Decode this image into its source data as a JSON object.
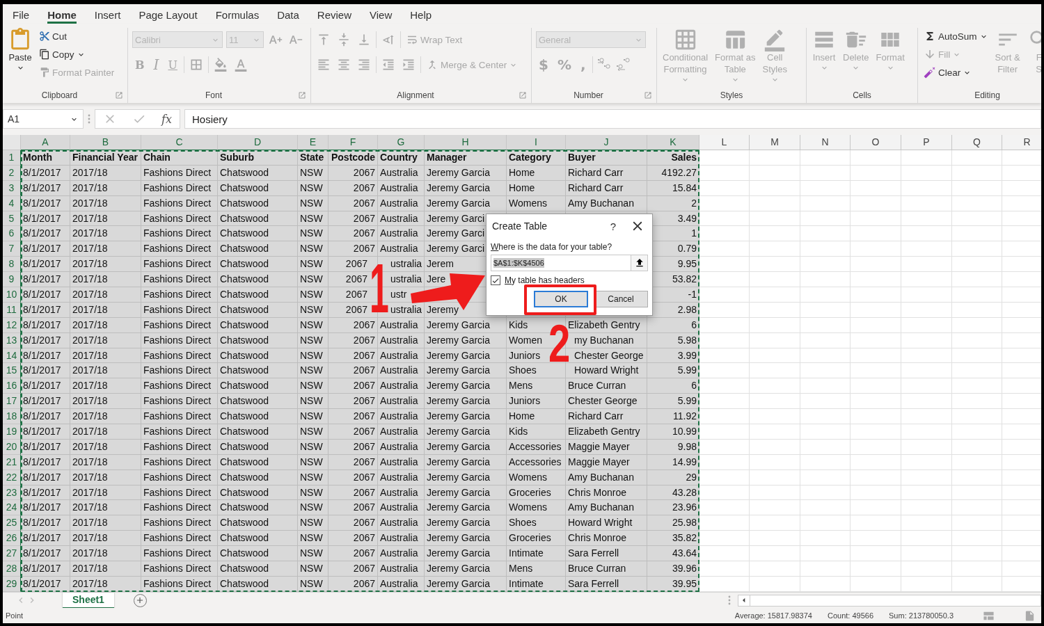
{
  "ribbon_tabs": [
    {
      "label": "File",
      "selected": false
    },
    {
      "label": "Home",
      "selected": true
    },
    {
      "label": "Insert",
      "selected": false
    },
    {
      "label": "Page Layout",
      "selected": false
    },
    {
      "label": "Formulas",
      "selected": false
    },
    {
      "label": "Data",
      "selected": false
    },
    {
      "label": "Review",
      "selected": false
    },
    {
      "label": "View",
      "selected": false
    },
    {
      "label": "Help",
      "selected": false
    }
  ],
  "ribbon": [
    {
      "kind": "clipboard",
      "title": "Clipboard",
      "items": [
        {
          "label": "Paste",
          "disabled": false
        },
        {
          "label": "Cut",
          "disabled": false
        },
        {
          "label": "Copy",
          "disabled": false
        },
        {
          "label": "Format Painter",
          "disabled": true
        }
      ]
    },
    {
      "kind": "font",
      "title": "Font",
      "font": "Calibri",
      "size": "11",
      "styles": [
        "B",
        "I",
        "U"
      ],
      "disabled": true
    },
    {
      "kind": "alignment",
      "title": "Alignment",
      "items": [
        {
          "label": "Wrap Text"
        },
        {
          "label": "Merge & Center"
        }
      ],
      "disabled": true
    },
    {
      "kind": "number",
      "title": "Number",
      "format": "General",
      "symbols": [
        "$",
        "%",
        ","
      ],
      "disabled": true
    },
    {
      "kind": "large",
      "title": "Styles",
      "items": [
        {
          "lines": [
            "Conditional",
            "Formatting"
          ],
          "disabled": true
        },
        {
          "lines": [
            "Format as",
            "Table"
          ],
          "disabled": true
        },
        {
          "lines": [
            "Cell",
            "Styles"
          ],
          "disabled": true
        }
      ]
    },
    {
      "kind": "large",
      "title": "Cells",
      "items": [
        {
          "lines": [
            "Insert"
          ],
          "disabled": true
        },
        {
          "lines": [
            "Delete"
          ],
          "disabled": true
        },
        {
          "lines": [
            "Format"
          ],
          "disabled": true
        }
      ]
    },
    {
      "kind": "editing",
      "title": "Editing",
      "items": [
        {
          "label": "AutoSum",
          "disabled": false
        },
        {
          "label": "Fill",
          "disabled": true
        },
        {
          "label": "Clear",
          "disabled": false
        }
      ],
      "large": [
        {
          "lines": [
            "Sort &",
            "Filter"
          ],
          "disabled": true
        },
        {
          "lines": [
            "F",
            "S"
          ],
          "disabled": true
        }
      ]
    }
  ],
  "formula_bar": {
    "name_box": "A1",
    "fx": "fx",
    "formula": "Hosiery"
  },
  "grid": {
    "marquee": true,
    "columns": [
      {
        "label": "A",
        "selected": true,
        "kind": "text"
      },
      {
        "label": "B",
        "selected": true,
        "kind": "text"
      },
      {
        "label": "C",
        "selected": true,
        "kind": "text"
      },
      {
        "label": "D",
        "selected": true,
        "kind": "text"
      },
      {
        "label": "E",
        "selected": true,
        "kind": "text"
      },
      {
        "label": "F",
        "selected": true,
        "kind": "number"
      },
      {
        "label": "G",
        "selected": true,
        "kind": "text"
      },
      {
        "label": "H",
        "selected": true,
        "kind": "text"
      },
      {
        "label": "I",
        "selected": true,
        "kind": "text"
      },
      {
        "label": "J",
        "selected": true,
        "kind": "text"
      },
      {
        "label": "K",
        "selected": true,
        "kind": "number"
      },
      {
        "label": "L",
        "selected": false,
        "kind": "text"
      },
      {
        "label": "M",
        "selected": false,
        "kind": "text"
      },
      {
        "label": "N",
        "selected": false,
        "kind": "text"
      },
      {
        "label": "O",
        "selected": false,
        "kind": "text"
      },
      {
        "label": "P",
        "selected": false,
        "kind": "text"
      },
      {
        "label": "Q",
        "selected": false,
        "kind": "text"
      },
      {
        "label": "R",
        "selected": false,
        "kind": "text"
      }
    ],
    "rows": [
      {
        "number": "1",
        "selected": true,
        "kind": "header",
        "cells": [
          "Month",
          "Financial Year",
          "Chain",
          "Suburb",
          "State",
          "Postcode",
          "Country",
          "Manager",
          "Category",
          "Buyer",
          "Sales"
        ]
      },
      {
        "number": "2",
        "selected": true,
        "kind": "data",
        "cells": [
          "8/1/2017",
          "2017/18",
          "Fashions Direct",
          "Chatswood",
          "NSW",
          "2067",
          "Australia",
          "Jeremy Garcia",
          "Home",
          "Richard Carr",
          "4192.27"
        ]
      },
      {
        "number": "3",
        "selected": true,
        "kind": "data",
        "cells": [
          "8/1/2017",
          "2017/18",
          "Fashions Direct",
          "Chatswood",
          "NSW",
          "2067",
          "Australia",
          "Jeremy Garcia",
          "Home",
          "Richard Carr",
          "15.84"
        ]
      },
      {
        "number": "4",
        "selected": true,
        "kind": "data",
        "cells": [
          "8/1/2017",
          "2017/18",
          "Fashions Direct",
          "Chatswood",
          "NSW",
          "2067",
          "Australia",
          "Jeremy Garcia",
          "Womens",
          "Amy Buchanan",
          "2"
        ]
      },
      {
        "number": "5",
        "selected": true,
        "kind": "data",
        "cells": [
          "8/1/2017",
          "2017/18",
          "Fashions Direct",
          "Chatswood",
          "NSW",
          "2067",
          "Australia",
          "Jeremy Garci",
          null,
          null,
          "3.49"
        ]
      },
      {
        "number": "6",
        "selected": true,
        "kind": "data",
        "cells": [
          "8/1/2017",
          "2017/18",
          "Fashions Direct",
          "Chatswood",
          "NSW",
          "2067",
          "Australia",
          "Jeremy Garci",
          null,
          null,
          "1"
        ]
      },
      {
        "number": "7",
        "selected": true,
        "kind": "data",
        "cells": [
          "8/1/2017",
          "2017/18",
          "Fashions Direct",
          "Chatswood",
          "NSW",
          "2067",
          "Australia",
          "Jeremy Garci",
          null,
          null,
          "0.79"
        ]
      },
      {
        "number": "8",
        "selected": true,
        "kind": "data",
        "cells": [
          "8/1/2017",
          "2017/18",
          "Fashions Direct",
          "Chatswood",
          "NSW",
          "2067",
          "ustralia",
          "Jerem",
          null,
          null,
          "9.95"
        ]
      },
      {
        "number": "9",
        "selected": true,
        "kind": "data",
        "cells": [
          "8/1/2017",
          "2017/18",
          "Fashions Direct",
          "Chatswood",
          "NSW",
          "2067",
          "ustralia",
          "Jere",
          null,
          null,
          "53.82"
        ]
      },
      {
        "number": "10",
        "selected": true,
        "kind": "data",
        "cells": [
          "8/1/2017",
          "2017/18",
          "Fashions Direct",
          "Chatswood",
          "NSW",
          "2067",
          "ustr",
          null,
          null,
          null,
          "-1"
        ]
      },
      {
        "number": "11",
        "selected": true,
        "kind": "data",
        "cells": [
          "8/1/2017",
          "2017/18",
          "Fashions Direct",
          "Chatswood",
          "NSW",
          "2067",
          "ustralia",
          "Jeremy",
          null,
          null,
          "2.98"
        ]
      },
      {
        "number": "12",
        "selected": true,
        "kind": "data",
        "cells": [
          "8/1/2017",
          "2017/18",
          "Fashions Direct",
          "Chatswood",
          "NSW",
          "2067",
          "Australia",
          "Jeremy Garcia",
          "Kids",
          "Elizabeth Gentry",
          "6"
        ]
      },
      {
        "number": "13",
        "selected": true,
        "kind": "data",
        "cells": [
          "8/1/2017",
          "2017/18",
          "Fashions Direct",
          "Chatswood",
          "NSW",
          "2067",
          "Australia",
          "Jeremy Garcia",
          "Women",
          "my Buchanan",
          "5.98"
        ]
      },
      {
        "number": "14",
        "selected": true,
        "kind": "data",
        "cells": [
          "8/1/2017",
          "2017/18",
          "Fashions Direct",
          "Chatswood",
          "NSW",
          "2067",
          "Australia",
          "Jeremy Garcia",
          "Juniors",
          "Chester George",
          "3.99"
        ]
      },
      {
        "number": "15",
        "selected": true,
        "kind": "data",
        "cells": [
          "8/1/2017",
          "2017/18",
          "Fashions Direct",
          "Chatswood",
          "NSW",
          "2067",
          "Australia",
          "Jeremy Garcia",
          "Shoes",
          "Howard Wright",
          "5.99"
        ]
      },
      {
        "number": "16",
        "selected": true,
        "kind": "data",
        "cells": [
          "8/1/2017",
          "2017/18",
          "Fashions Direct",
          "Chatswood",
          "NSW",
          "2067",
          "Australia",
          "Jeremy Garcia",
          "Mens",
          "Bruce Curran",
          "6"
        ]
      },
      {
        "number": "17",
        "selected": true,
        "kind": "data",
        "cells": [
          "8/1/2017",
          "2017/18",
          "Fashions Direct",
          "Chatswood",
          "NSW",
          "2067",
          "Australia",
          "Jeremy Garcia",
          "Juniors",
          "Chester George",
          "5.99"
        ]
      },
      {
        "number": "18",
        "selected": true,
        "kind": "data",
        "cells": [
          "8/1/2017",
          "2017/18",
          "Fashions Direct",
          "Chatswood",
          "NSW",
          "2067",
          "Australia",
          "Jeremy Garcia",
          "Home",
          "Richard Carr",
          "11.92"
        ]
      },
      {
        "number": "19",
        "selected": true,
        "kind": "data",
        "cells": [
          "8/1/2017",
          "2017/18",
          "Fashions Direct",
          "Chatswood",
          "NSW",
          "2067",
          "Australia",
          "Jeremy Garcia",
          "Kids",
          "Elizabeth Gentry",
          "10.99"
        ]
      },
      {
        "number": "20",
        "selected": true,
        "kind": "data",
        "cells": [
          "8/1/2017",
          "2017/18",
          "Fashions Direct",
          "Chatswood",
          "NSW",
          "2067",
          "Australia",
          "Jeremy Garcia",
          "Accessories",
          "Maggie Mayer",
          "9.98"
        ]
      },
      {
        "number": "21",
        "selected": true,
        "kind": "data",
        "cells": [
          "8/1/2017",
          "2017/18",
          "Fashions Direct",
          "Chatswood",
          "NSW",
          "2067",
          "Australia",
          "Jeremy Garcia",
          "Accessories",
          "Maggie Mayer",
          "14.99"
        ]
      },
      {
        "number": "22",
        "selected": true,
        "kind": "data",
        "cells": [
          "8/1/2017",
          "2017/18",
          "Fashions Direct",
          "Chatswood",
          "NSW",
          "2067",
          "Australia",
          "Jeremy Garcia",
          "Womens",
          "Amy Buchanan",
          "29"
        ]
      },
      {
        "number": "23",
        "selected": true,
        "kind": "data",
        "cells": [
          "8/1/2017",
          "2017/18",
          "Fashions Direct",
          "Chatswood",
          "NSW",
          "2067",
          "Australia",
          "Jeremy Garcia",
          "Groceries",
          "Chris Monroe",
          "43.28"
        ]
      },
      {
        "number": "24",
        "selected": true,
        "kind": "data",
        "cells": [
          "8/1/2017",
          "2017/18",
          "Fashions Direct",
          "Chatswood",
          "NSW",
          "2067",
          "Australia",
          "Jeremy Garcia",
          "Womens",
          "Amy Buchanan",
          "23.96"
        ]
      },
      {
        "number": "25",
        "selected": true,
        "kind": "data",
        "cells": [
          "8/1/2017",
          "2017/18",
          "Fashions Direct",
          "Chatswood",
          "NSW",
          "2067",
          "Australia",
          "Jeremy Garcia",
          "Shoes",
          "Howard Wright",
          "25.98"
        ]
      },
      {
        "number": "26",
        "selected": true,
        "kind": "data",
        "cells": [
          "8/1/2017",
          "2017/18",
          "Fashions Direct",
          "Chatswood",
          "NSW",
          "2067",
          "Australia",
          "Jeremy Garcia",
          "Groceries",
          "Chris Monroe",
          "35.82"
        ]
      },
      {
        "number": "27",
        "selected": true,
        "kind": "data",
        "cells": [
          "8/1/2017",
          "2017/18",
          "Fashions Direct",
          "Chatswood",
          "NSW",
          "2067",
          "Australia",
          "Jeremy Garcia",
          "Intimate",
          "Sara Ferrell",
          "43.64"
        ]
      },
      {
        "number": "28",
        "selected": true,
        "kind": "data",
        "cells": [
          "8/1/2017",
          "2017/18",
          "Fashions Direct",
          "Chatswood",
          "NSW",
          "2067",
          "Australia",
          "Jeremy Garcia",
          "Mens",
          "Bruce Curran",
          "39.96"
        ]
      },
      {
        "number": "29",
        "selected": true,
        "kind": "data",
        "cells": [
          "8/1/2017",
          "2017/18",
          "Fashions Direct",
          "Chatswood",
          "NSW",
          "2067",
          "Australia",
          "Jeremy Garcia",
          "Intimate",
          "Sara Ferrell",
          "39.95"
        ]
      }
    ]
  },
  "dialog": {
    "title": "Create Table",
    "help": "?",
    "prompt": "Where is the data for your table?",
    "range": "$A$1:$K$4506",
    "headers_checkbox": {
      "label": "My table has headers",
      "checked": true
    },
    "buttons": [
      {
        "label": "OK",
        "default": true
      },
      {
        "label": "Cancel",
        "default": false
      }
    ]
  },
  "annotations": [
    {
      "kind": "number",
      "text": "1"
    },
    {
      "kind": "arrow"
    },
    {
      "kind": "number",
      "text": "2"
    },
    {
      "kind": "highlight"
    }
  ],
  "sheet_tabs": [
    {
      "label": "Sheet1",
      "selected": true
    }
  ],
  "status_bar": {
    "mode": "Point",
    "stats": [
      "Average: 15817.98374",
      "Count: 49566",
      "Sum: 213780050.3"
    ]
  }
}
